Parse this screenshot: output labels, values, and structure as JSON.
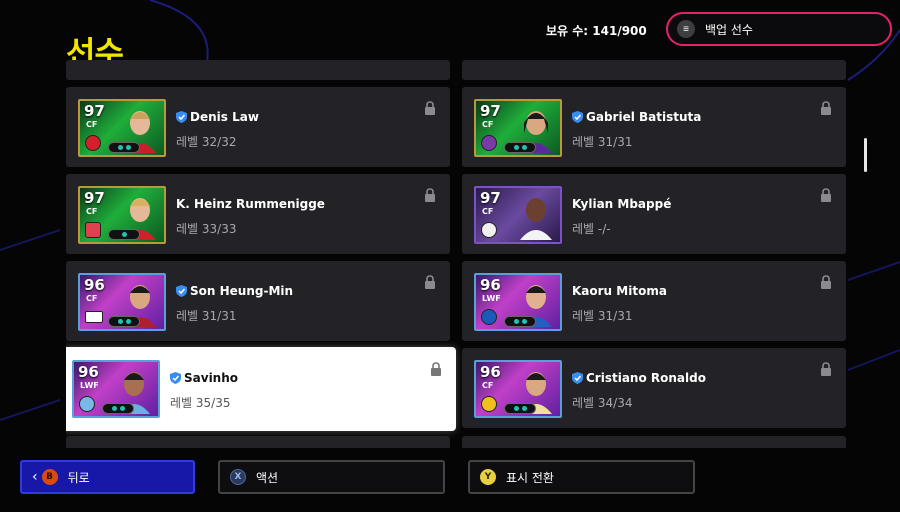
{
  "header": {
    "title": "선수",
    "owned_label": "보유 수: 141/900",
    "backup_label": "백업 선수"
  },
  "players_left": [
    {
      "name": "Denis Law",
      "verified": true,
      "level": "레벨 32/32",
      "rating": "97",
      "position": "CF",
      "card_style": "gold-green"
    },
    {
      "name": "K. Heinz Rummenigge",
      "verified": false,
      "level": "레벨 33/33",
      "rating": "97",
      "position": "CF",
      "card_style": "gold-green"
    },
    {
      "name": "Son Heung-Min",
      "verified": true,
      "level": "레벨 31/31",
      "rating": "96",
      "position": "CF",
      "card_style": "purple-pink"
    },
    {
      "name": "Savinho",
      "verified": true,
      "level": "레벨 35/35",
      "rating": "96",
      "position": "LWF",
      "card_style": "purple-pink",
      "selected": true
    }
  ],
  "players_right": [
    {
      "name": "Gabriel Batistuta",
      "verified": true,
      "level": "레벨 31/31",
      "rating": "97",
      "position": "CF",
      "card_style": "gold-green"
    },
    {
      "name": "Kylian Mbappé",
      "verified": false,
      "level": "레벨 -/-",
      "rating": "97",
      "position": "CF",
      "card_style": "purple"
    },
    {
      "name": "Kaoru Mitoma",
      "verified": false,
      "level": "레벨 31/31",
      "rating": "96",
      "position": "LWF",
      "card_style": "purple-pink"
    },
    {
      "name": "Cristiano Ronaldo",
      "verified": true,
      "level": "레벨 34/34",
      "rating": "96",
      "position": "CF",
      "card_style": "purple-pink"
    }
  ],
  "footer": {
    "back": {
      "key": "B",
      "label": "뒤로"
    },
    "action": {
      "key": "X",
      "label": "액션"
    },
    "toggle": {
      "key": "Y",
      "label": "표시 전환"
    }
  },
  "colors": {
    "title": "#f2e600",
    "accent_pink": "#e8206a",
    "back_button": "#1818a8",
    "verified_badge": "#3a8df0"
  },
  "icons": {
    "menu": "menu-icon",
    "lock": "lock-icon",
    "verified": "verified-shield-icon",
    "back": "chevron-left-icon"
  }
}
